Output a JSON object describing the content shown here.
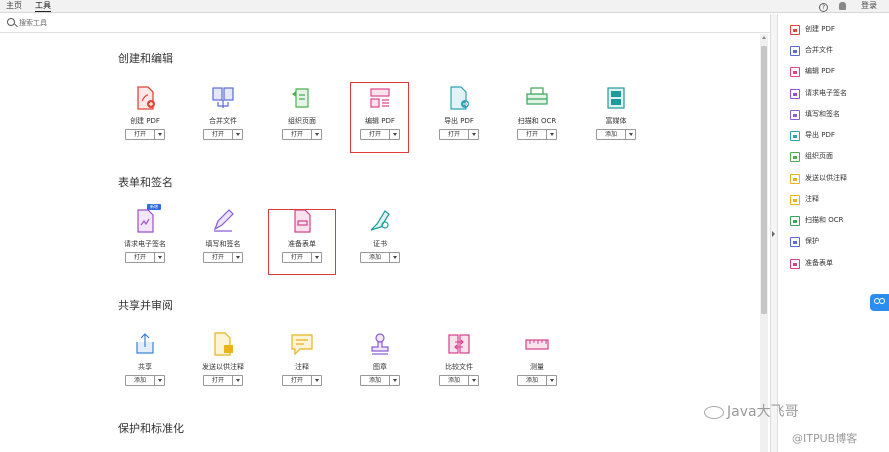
{
  "nav": {
    "home": "主页",
    "tools": "工具",
    "help": "?",
    "login": "登录"
  },
  "search": {
    "placeholder": "搜索工具"
  },
  "sections": {
    "create_edit": "创建和编辑",
    "forms_sign": "表单和签名",
    "share_review": "共享并审阅",
    "protect": "保护和标准化"
  },
  "tools": {
    "create_pdf": {
      "label": "创建 PDF",
      "button": "打开"
    },
    "combine": {
      "label": "合并文件",
      "button": "打开"
    },
    "organize": {
      "label": "组织页面",
      "button": "打开"
    },
    "edit_pdf": {
      "label": "编辑 PDF",
      "button": "打开"
    },
    "export_pdf": {
      "label": "导出 PDF",
      "button": "打开"
    },
    "scan_ocr": {
      "label": "扫描和 OCR",
      "button": "打开"
    },
    "rich_media": {
      "label": "富媒体",
      "button": "添加"
    },
    "request_esign": {
      "label": "请求电子签名",
      "button": "打开"
    },
    "fill_sign": {
      "label": "填写和签名",
      "button": "打开"
    },
    "prepare_form": {
      "label": "准备表单",
      "button": "打开"
    },
    "certificate": {
      "label": "证书",
      "button": "添加"
    },
    "share": {
      "label": "共享",
      "button": "添加"
    },
    "send_comment": {
      "label": "发送以供注释",
      "button": "打开"
    },
    "comment": {
      "label": "注释",
      "button": "打开"
    },
    "stamp": {
      "label": "图章",
      "button": "添加"
    },
    "compare": {
      "label": "比较文件",
      "button": "添加"
    },
    "measure": {
      "label": "测量",
      "button": "添加"
    }
  },
  "right_panel": [
    {
      "label": "创建 PDF",
      "icon": "create-pdf-icon",
      "color": "#e0463c"
    },
    {
      "label": "合并文件",
      "icon": "combine-files-icon",
      "color": "#5a6bd8"
    },
    {
      "label": "编辑 PDF",
      "icon": "edit-pdf-icon",
      "color": "#e0468c"
    },
    {
      "label": "请求电子签名",
      "icon": "request-signature-icon",
      "color": "#9b4fd0"
    },
    {
      "label": "填写和签名",
      "icon": "fill-sign-icon",
      "color": "#8a5cd6"
    },
    {
      "label": "导出 PDF",
      "icon": "export-pdf-icon",
      "color": "#2fa3b8"
    },
    {
      "label": "组织页面",
      "icon": "organize-pages-icon",
      "color": "#4caf50"
    },
    {
      "label": "发送以供注释",
      "icon": "send-comment-icon",
      "color": "#e8b418"
    },
    {
      "label": "注释",
      "icon": "comment-icon",
      "color": "#e8b418"
    },
    {
      "label": "扫描和 OCR",
      "icon": "scan-ocr-icon",
      "color": "#3aa55a"
    },
    {
      "label": "保护",
      "icon": "protect-icon",
      "color": "#5a6bd8"
    },
    {
      "label": "准备表单",
      "icon": "prepare-form-icon",
      "color": "#d6408a"
    }
  ],
  "badge": {
    "new": "新增"
  },
  "watermark": {
    "line1": "Java大飞哥",
    "line2": "@ITPUB博客"
  },
  "colors": {
    "highlight": "#e03a3a",
    "accent": "#2c8df0"
  }
}
